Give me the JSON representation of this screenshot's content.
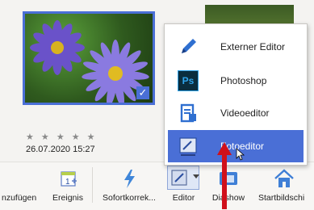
{
  "photo": {
    "date": "26.07.2020 15:27",
    "rating_stars": "★ ★ ★ ★ ★",
    "selected_check": "✓"
  },
  "popup_menu": {
    "items": [
      {
        "label": "Externer Editor",
        "icon": "pen-icon"
      },
      {
        "label": "Photoshop",
        "icon": "photoshop-icon",
        "icon_text": "Ps"
      },
      {
        "label": "Videoeditor",
        "icon": "video-editor-icon"
      },
      {
        "label": "Fotoeditor",
        "icon": "photo-editor-icon",
        "active": true
      }
    ]
  },
  "toolbar": {
    "items": [
      {
        "label": "nzufügen",
        "icon": "add-icon"
      },
      {
        "label": "Ereignis",
        "icon": "event-icon"
      },
      {
        "label": "Sofortkorrek...",
        "icon": "lightning-icon"
      },
      {
        "label": "Editor",
        "icon": "editor-icon"
      },
      {
        "label": "Diashow",
        "icon": "slideshow-icon"
      },
      {
        "label": "Startbildschi",
        "icon": "home-icon"
      }
    ]
  },
  "colors": {
    "accent": "#4a6fd6",
    "annotation_arrow": "#d0101b"
  }
}
